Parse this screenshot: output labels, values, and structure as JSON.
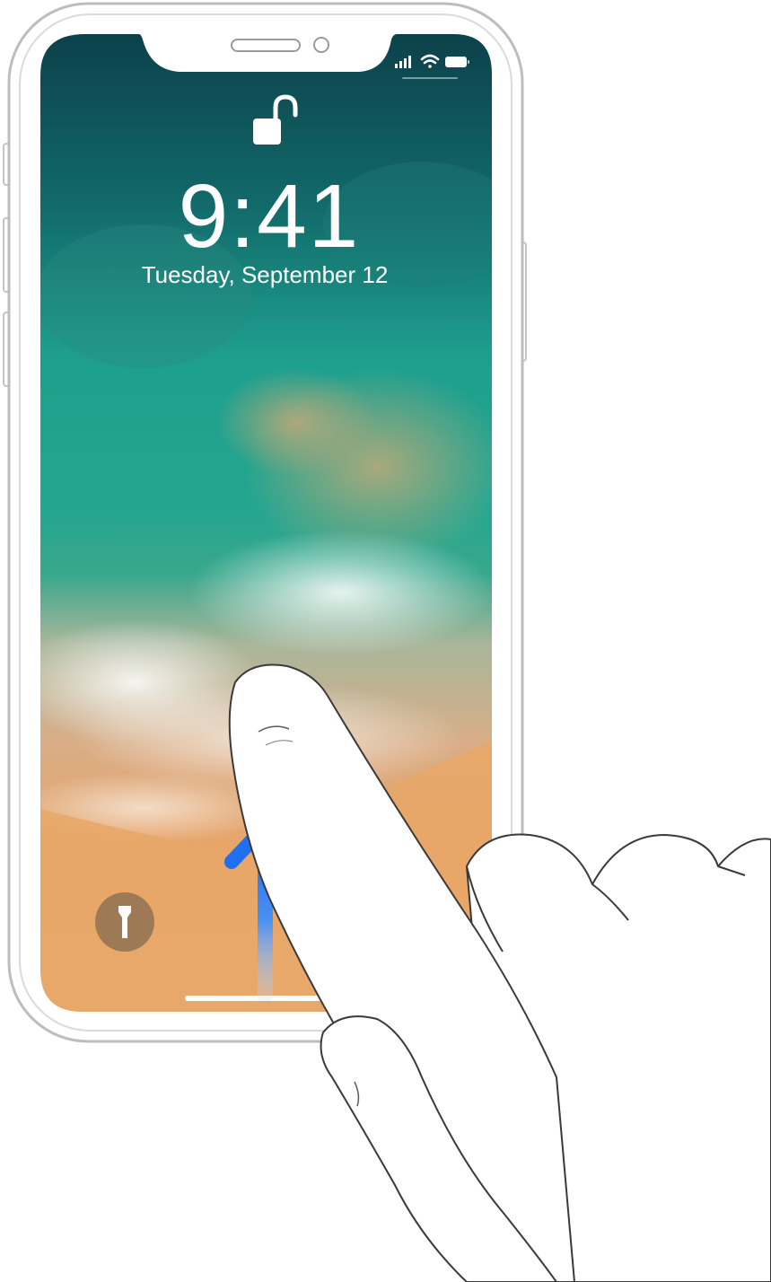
{
  "lock_screen": {
    "time": "9:41",
    "date": "Tuesday, September 12",
    "status_bar": {
      "icons": [
        "signal-bars-icon",
        "wifi-icon",
        "battery-icon"
      ]
    },
    "lock_state_icon": "unlocked-padlock-icon",
    "flashlight_icon": "flashlight-icon",
    "home_indicator": "home-indicator"
  },
  "illustration": {
    "gesture": "swipe-up",
    "arrow_color": "#1f6ff0",
    "hand": "index-finger-hand"
  },
  "colors": {
    "wallpaper_deep_sea": "#0c3f49",
    "wallpaper_sea": "#1e9f8e",
    "wallpaper_sand": "#e9a96a",
    "phone_frame": "#bdbdbd",
    "flashlight_button": "#8f7152"
  }
}
